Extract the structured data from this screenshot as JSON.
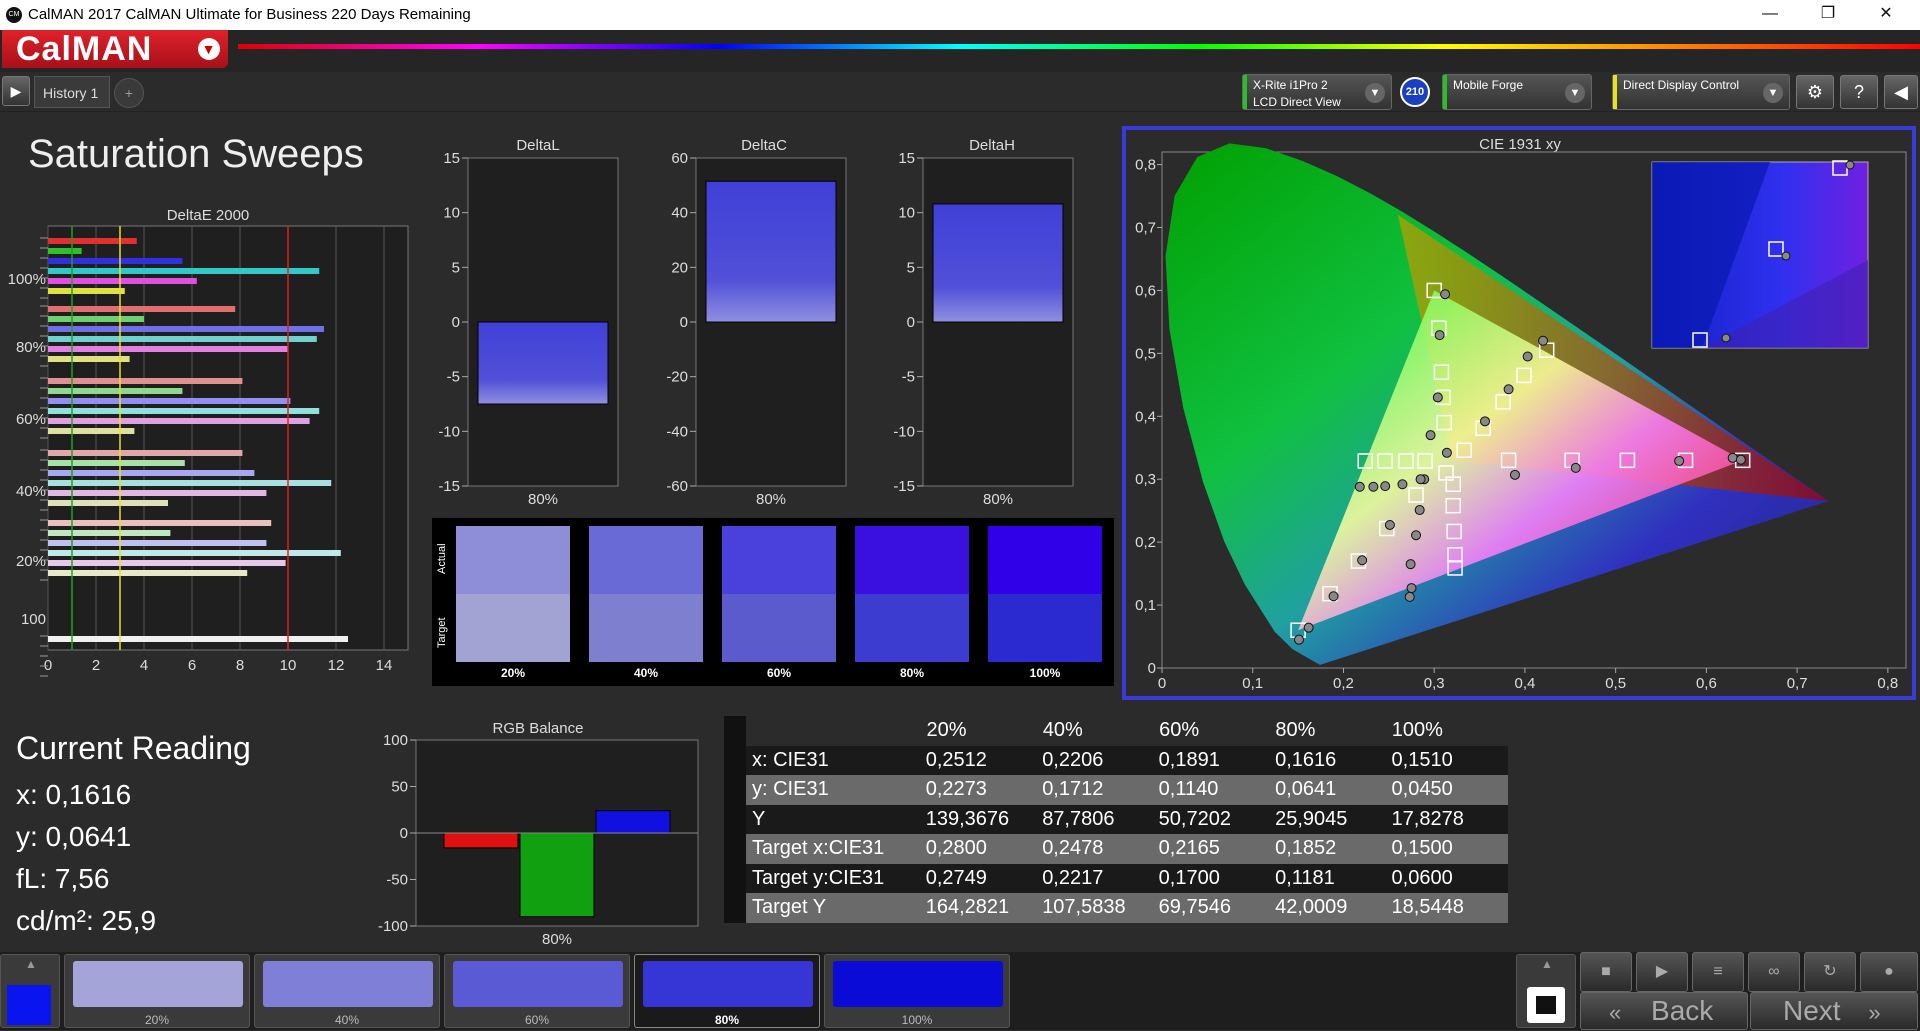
{
  "window": {
    "title": "CalMAN 2017 CalMAN Ultimate for Business 220 Days Remaining"
  },
  "header": {
    "logo": "CalMAN",
    "tab_label": "History 1",
    "devices": [
      {
        "line1": "X-Rite i1Pro 2",
        "line2": "LCD Direct View",
        "color": "#28c028"
      },
      {
        "line1": "Mobile Forge",
        "line2": "",
        "color": "#28c028"
      },
      {
        "line1": "Direct Display Control",
        "line2": "",
        "color": "#e8e020"
      }
    ],
    "badge": "210"
  },
  "page": {
    "title": "Saturation Sweeps"
  },
  "deltae_chart": {
    "title": "DeltaE 2000",
    "x_ticks": [
      "0",
      "2",
      "4",
      "6",
      "8",
      "10",
      "12",
      "14"
    ],
    "y_labels": [
      "100%",
      "80%",
      "60%",
      "40%",
      "20%",
      "100"
    ],
    "xlim": [
      0,
      15
    ],
    "markers": [
      {
        "value": 1,
        "color": "#1fa01f"
      },
      {
        "value": 3,
        "color": "#e8e020"
      },
      {
        "value": 10,
        "color": "#e02020"
      }
    ],
    "groups": [
      {
        "bars": [
          {
            "v": 3.7,
            "c": "#e03030"
          },
          {
            "v": 1.4,
            "c": "#30c030"
          },
          {
            "v": 5.6,
            "c": "#3030e0"
          },
          {
            "v": 11.3,
            "c": "#30c8c8"
          },
          {
            "v": 6.2,
            "c": "#e050e0"
          },
          {
            "v": 3.2,
            "c": "#e0e040"
          }
        ]
      },
      {
        "bars": [
          {
            "v": 7.8,
            "c": "#e07070"
          },
          {
            "v": 4.0,
            "c": "#70d070"
          },
          {
            "v": 11.5,
            "c": "#7070e8"
          },
          {
            "v": 11.2,
            "c": "#70d0d0"
          },
          {
            "v": 10.0,
            "c": "#e080e0"
          },
          {
            "v": 3.4,
            "c": "#e0e080"
          }
        ]
      },
      {
        "bars": [
          {
            "v": 8.1,
            "c": "#e09090"
          },
          {
            "v": 5.6,
            "c": "#90d890"
          },
          {
            "v": 10.1,
            "c": "#9090f0"
          },
          {
            "v": 11.3,
            "c": "#90e0e0"
          },
          {
            "v": 10.9,
            "c": "#e0a0e0"
          },
          {
            "v": 3.6,
            "c": "#e0e0a0"
          }
        ]
      },
      {
        "bars": [
          {
            "v": 8.1,
            "c": "#e0a8a8"
          },
          {
            "v": 5.7,
            "c": "#a8e0a8"
          },
          {
            "v": 8.6,
            "c": "#a8a8f0"
          },
          {
            "v": 11.8,
            "c": "#a8e0e0"
          },
          {
            "v": 9.1,
            "c": "#e0b8e0"
          },
          {
            "v": 5.0,
            "c": "#e0e0b8"
          }
        ]
      },
      {
        "bars": [
          {
            "v": 9.3,
            "c": "#e8c0c0"
          },
          {
            "v": 5.1,
            "c": "#c0e8c0"
          },
          {
            "v": 9.1,
            "c": "#c0c0f0"
          },
          {
            "v": 12.2,
            "c": "#c0e8e8"
          },
          {
            "v": 9.9,
            "c": "#e8c8e8"
          },
          {
            "v": 8.3,
            "c": "#e8e8c8"
          }
        ]
      },
      {
        "bars": [
          {
            "v": 12.5,
            "c": "#f0f0f0"
          }
        ]
      }
    ]
  },
  "delta_charts": [
    {
      "name": "DeltaL",
      "value": -7.5,
      "lim": 15,
      "ticks": [
        "15",
        "10",
        "5",
        "0",
        "-5",
        "-10",
        "-15"
      ],
      "xlabel": "80%"
    },
    {
      "name": "DeltaC",
      "value": 51.5,
      "lim": 60,
      "ticks": [
        "60",
        "40",
        "20",
        "0",
        "-20",
        "-40",
        "-60"
      ],
      "xlabel": "80%"
    },
    {
      "name": "DeltaH",
      "value": 10.8,
      "lim": 15,
      "ticks": [
        "15",
        "10",
        "5",
        "0",
        "-5",
        "-10",
        "-15"
      ],
      "xlabel": "80%"
    }
  ],
  "swatches": {
    "actual_label": "Actual",
    "target_label": "Target",
    "items": [
      {
        "label": "20%",
        "actual": "#8e8ed8",
        "target": "#a3a3d3"
      },
      {
        "label": "40%",
        "actual": "#6a6ad6",
        "target": "#7f7fcf"
      },
      {
        "label": "60%",
        "actual": "#4a40dc",
        "target": "#5b5bce"
      },
      {
        "label": "80%",
        "actual": "#3a10e0",
        "target": "#3c3cd0"
      },
      {
        "label": "100%",
        "actual": "#3000e8",
        "target": "#2a2ad0"
      }
    ]
  },
  "cie_chart": {
    "title": "CIE 1931 xy",
    "x_ticks": [
      "0",
      "0,1",
      "0,2",
      "0,3",
      "0,4",
      "0,5",
      "0,6",
      "0,7",
      "0,8"
    ],
    "y_ticks": [
      "0",
      "0,1",
      "0,2",
      "0,3",
      "0,4",
      "0,5",
      "0,6",
      "0,7",
      "0,8"
    ],
    "white_point": [
      0.3127,
      0.329
    ],
    "primaries": {
      "red": [
        0.64,
        0.33
      ],
      "green": [
        0.3,
        0.6
      ],
      "blue": [
        0.15,
        0.06
      ]
    },
    "targets": [
      [
        0.28,
        0.2749
      ],
      [
        0.2478,
        0.2217
      ],
      [
        0.2165,
        0.17
      ],
      [
        0.1852,
        0.1181
      ],
      [
        0.15,
        0.06
      ],
      [
        0.3,
        0.6
      ],
      [
        0.305,
        0.54
      ],
      [
        0.308,
        0.47
      ],
      [
        0.31,
        0.43
      ],
      [
        0.311,
        0.39
      ],
      [
        0.382,
        0.33
      ],
      [
        0.452,
        0.33
      ],
      [
        0.513,
        0.33
      ],
      [
        0.577,
        0.33
      ],
      [
        0.64,
        0.33
      ],
      [
        0.424,
        0.505
      ],
      [
        0.399,
        0.465
      ],
      [
        0.376,
        0.423
      ],
      [
        0.354,
        0.381
      ],
      [
        0.333,
        0.346
      ],
      [
        0.224,
        0.329
      ],
      [
        0.246,
        0.329
      ],
      [
        0.269,
        0.329
      ],
      [
        0.29,
        0.329
      ],
      [
        0.313,
        0.31
      ],
      [
        0.321,
        0.258
      ],
      [
        0.322,
        0.217
      ],
      [
        0.323,
        0.18
      ],
      [
        0.321,
        0.292
      ],
      [
        0.323,
        0.159
      ]
    ],
    "measured": [
      [
        0.2512,
        0.2273
      ],
      [
        0.2206,
        0.1712
      ],
      [
        0.1891,
        0.114
      ],
      [
        0.1616,
        0.0641
      ],
      [
        0.151,
        0.045
      ],
      [
        0.312,
        0.594
      ],
      [
        0.306,
        0.529
      ],
      [
        0.304,
        0.43
      ],
      [
        0.296,
        0.37
      ],
      [
        0.289,
        0.3
      ],
      [
        0.389,
        0.307
      ],
      [
        0.456,
        0.318
      ],
      [
        0.57,
        0.329
      ],
      [
        0.629,
        0.334
      ],
      [
        0.638,
        0.331
      ],
      [
        0.42,
        0.52
      ],
      [
        0.403,
        0.495
      ],
      [
        0.382,
        0.443
      ],
      [
        0.356,
        0.392
      ],
      [
        0.314,
        0.342
      ],
      [
        0.218,
        0.288
      ],
      [
        0.233,
        0.288
      ],
      [
        0.246,
        0.289
      ],
      [
        0.265,
        0.292
      ],
      [
        0.285,
        0.3
      ],
      [
        0.284,
        0.251
      ],
      [
        0.28,
        0.211
      ],
      [
        0.274,
        0.165
      ],
      [
        0.275,
        0.127
      ],
      [
        0.273,
        0.113
      ]
    ]
  },
  "rgb_balance": {
    "title": "RGB Balance",
    "ticks": [
      "100",
      "50",
      "0",
      "-50",
      "-100"
    ],
    "ylim": [
      -100,
      100
    ],
    "bars": [
      {
        "v": -16,
        "c": "#e01010"
      },
      {
        "v": -90,
        "c": "#10a010"
      },
      {
        "v": 24,
        "c": "#1010e0"
      }
    ],
    "xlabel": "80%"
  },
  "current_reading": {
    "heading": "Current Reading",
    "x": "x: 0,1616",
    "y": "y: 0,0641",
    "fl": "fL: 7,56",
    "cd": "cd/m²: 25,9"
  },
  "data_table": {
    "columns": [
      "20%",
      "40%",
      "60%",
      "80%",
      "100%"
    ],
    "rows": [
      {
        "label": "x: CIE31",
        "values": [
          "0,2512",
          "0,2206",
          "0,1891",
          "0,1616",
          "0,1510"
        ]
      },
      {
        "label": "y: CIE31",
        "values": [
          "0,2273",
          "0,1712",
          "0,1140",
          "0,0641",
          "0,0450"
        ]
      },
      {
        "label": "Y",
        "values": [
          "139,3676",
          "87,7806",
          "50,7202",
          "25,9045",
          "17,8278"
        ]
      },
      {
        "label": "Target x:CIE31",
        "values": [
          "0,2800",
          "0,2478",
          "0,2165",
          "0,1852",
          "0,1500"
        ]
      },
      {
        "label": "Target y:CIE31",
        "values": [
          "0,2749",
          "0,2217",
          "0,1700",
          "0,1181",
          "0,0600"
        ]
      },
      {
        "label": "Target Y",
        "values": [
          "164,2821",
          "107,5838",
          "69,7546",
          "42,0009",
          "18,5448"
        ]
      }
    ]
  },
  "patches": [
    {
      "label": "20%",
      "color": "#a4a4d8"
    },
    {
      "label": "40%",
      "color": "#7f7fd8"
    },
    {
      "label": "60%",
      "color": "#5a5ad4"
    },
    {
      "label": "80%",
      "color": "#3636d6",
      "active": true
    },
    {
      "label": "100%",
      "color": "#0b0bd8"
    }
  ],
  "controls": {
    "back": "Back",
    "next": "Next",
    "current_color": "#0a14f0"
  }
}
